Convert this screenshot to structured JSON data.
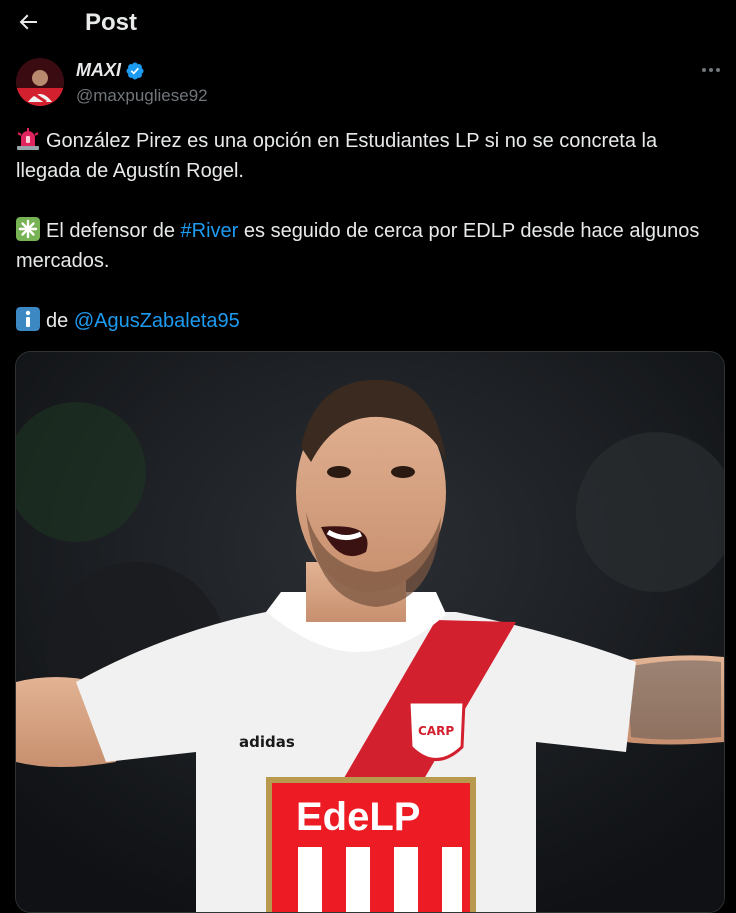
{
  "header": {
    "title": "Post"
  },
  "author": {
    "display_name": "MAXI",
    "handle": "@maxpugliese92"
  },
  "tweet": {
    "line1_text": "González Pirez es una opción en Estudiantes LP si no se concreta la llegada de Agustín Rogel.",
    "line2_before": "El defensor de ",
    "line2_hashtag": "#River",
    "line2_after": " es seguido de cerca por EDLP desde hace algunos mercados.",
    "line3_before": "de ",
    "line3_mention": "@AgusZabaleta95"
  },
  "media": {
    "badge_text": "EdeLP",
    "jersey_brand": "adidas",
    "crest_text": "CARP"
  },
  "colors": {
    "accent": "#1d9bf0",
    "text": "#e7e9ea",
    "muted": "#71767b",
    "background": "#000000",
    "river_red": "#d3202e"
  }
}
